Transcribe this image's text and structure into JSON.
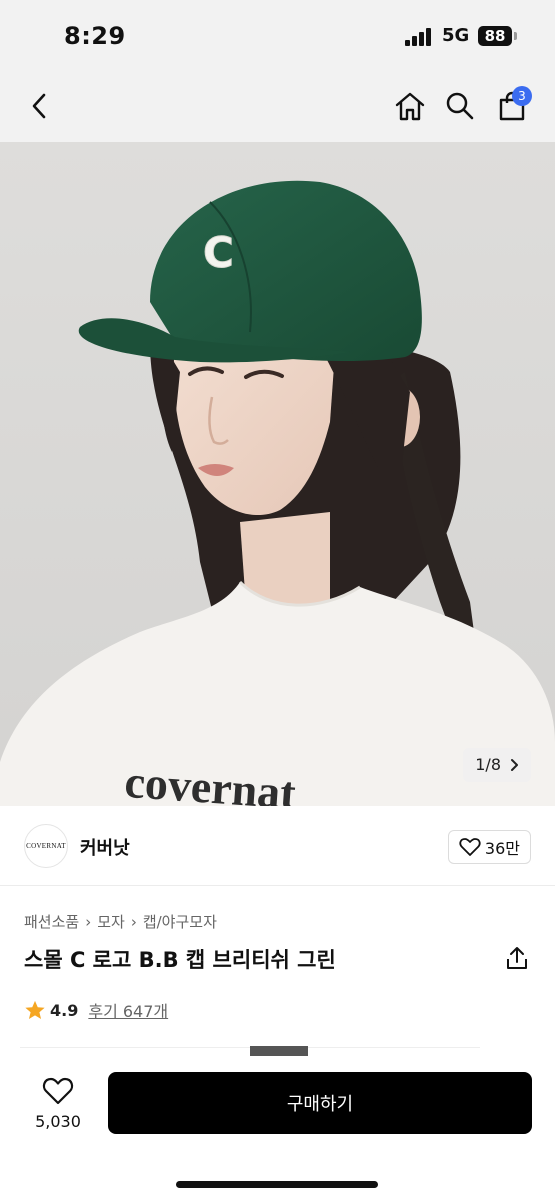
{
  "status_bar": {
    "time": "8:29",
    "network": "5G",
    "battery": "88"
  },
  "nav": {
    "cart_count": "3"
  },
  "hero": {
    "counter": "1/8",
    "shirt_text": "covernat",
    "cap_letter": "C"
  },
  "brand": {
    "logo_text": "COVERNAT",
    "name": "커버낫",
    "likes": "36만"
  },
  "product": {
    "breadcrumb": [
      "패션소품",
      "모자",
      "캡/야구모자"
    ],
    "title": "스몰 C 로고 B.B 캡 브리티쉬 그린",
    "rating": "4.9",
    "reviews": "후기 647개"
  },
  "bottom": {
    "wish_count": "5,030",
    "buy_label": "구매하기"
  },
  "colors": {
    "cap_green": "#1f5a3e",
    "badge_blue": "#3b6cf0",
    "star": "#f5a623"
  }
}
